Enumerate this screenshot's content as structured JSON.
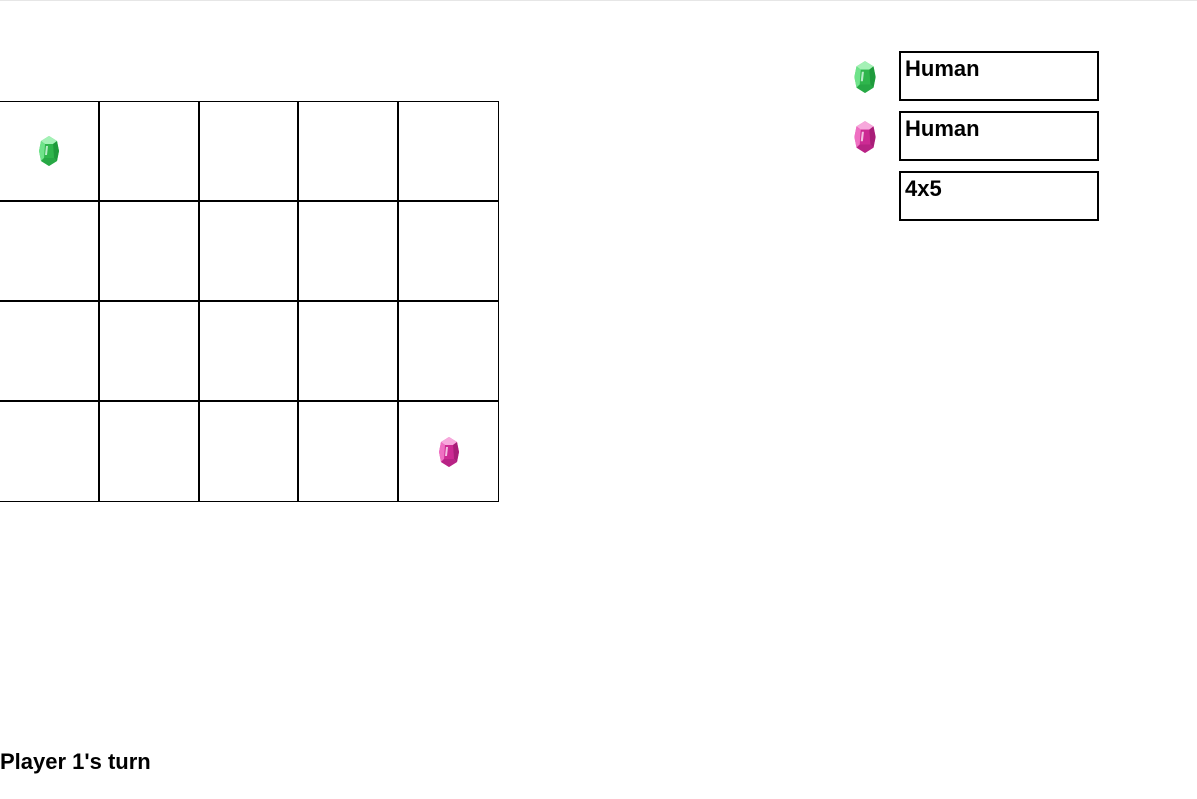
{
  "colors": {
    "player1": "#3ccf5a",
    "player2": "#e23aa8",
    "grid": "#000000"
  },
  "board": {
    "rows": 4,
    "cols": 5,
    "pieces": [
      {
        "row": 0,
        "col": 0,
        "player": 1,
        "icon": "green-gem-icon"
      },
      {
        "row": 3,
        "col": 4,
        "player": 2,
        "icon": "pink-gem-icon"
      }
    ]
  },
  "settings": {
    "player1": {
      "icon": "green-gem-icon",
      "value": "Human"
    },
    "player2": {
      "icon": "pink-gem-icon",
      "value": "Human"
    },
    "board_size": {
      "value": "4x5"
    }
  },
  "status": {
    "text": "Player 1's turn"
  }
}
